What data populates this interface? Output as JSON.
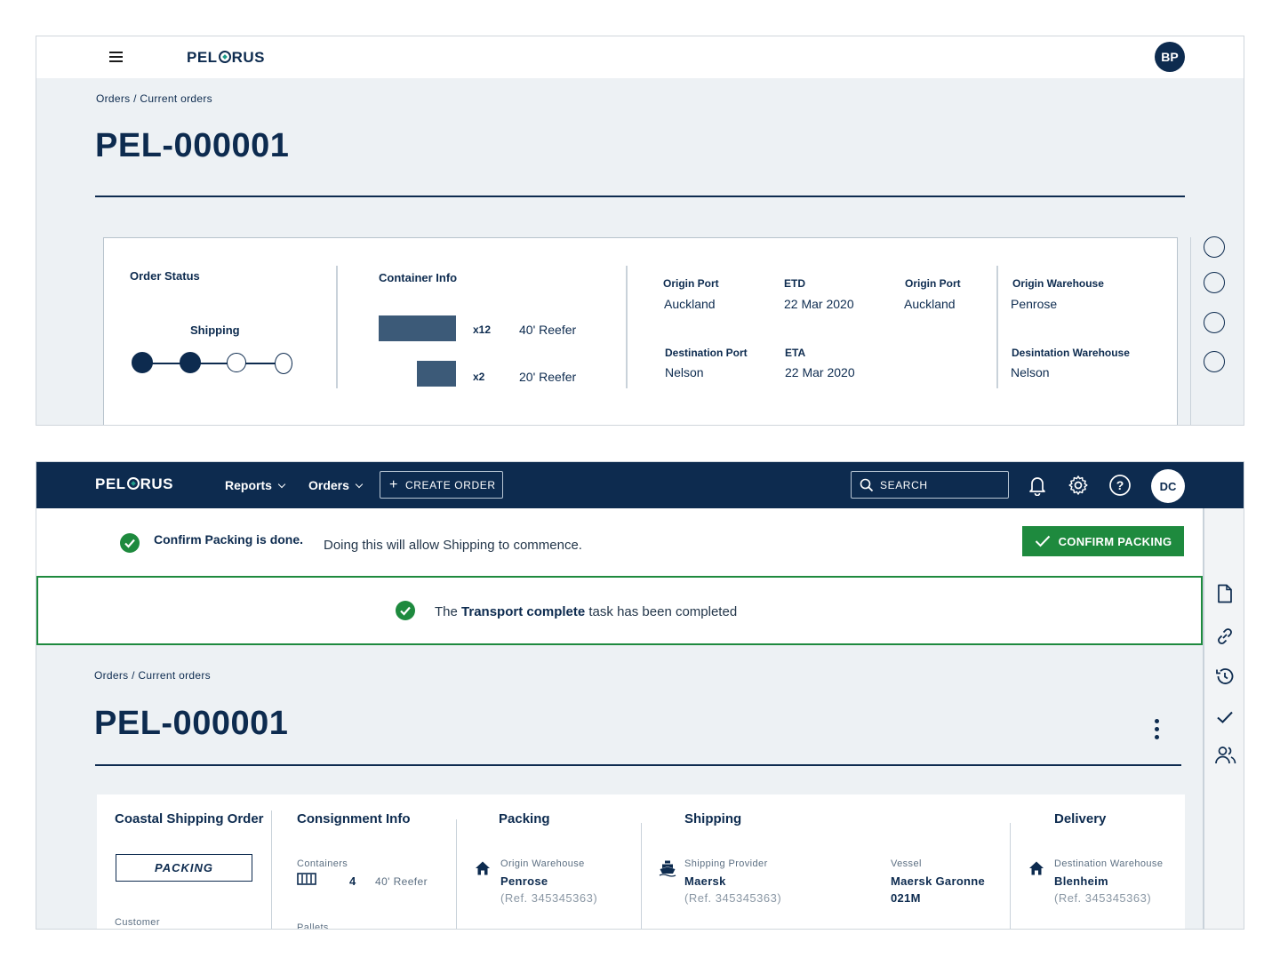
{
  "top": {
    "logo": {
      "left": "PEL",
      "right": "RUS"
    },
    "avatar": "BP",
    "breadcrumb": "Orders / Current orders",
    "title": "PEL-000001",
    "order_status": {
      "heading": "Order Status",
      "current": "Shipping",
      "steps_complete": 2,
      "steps_total": 4
    },
    "container_info": {
      "heading": "Container Info",
      "items": [
        {
          "qty": "x12",
          "type": "40' Reefer"
        },
        {
          "qty": "x2",
          "type": "20' Reefer"
        }
      ]
    },
    "route": {
      "origin_port_label": "Origin Port",
      "origin_port": "Auckland",
      "etd_label": "ETD",
      "etd": "22 Mar 2020",
      "origin_port2_label": "Origin Port",
      "origin_port2": "Auckland",
      "dest_port_label": "Destination Port",
      "dest_port": "Nelson",
      "eta_label": "ETA",
      "eta": "22 Mar 2020",
      "origin_wh_label": "Origin Warehouse",
      "origin_wh": "Penrose",
      "dest_wh_label": "Desintation Warehouse",
      "dest_wh": "Nelson"
    }
  },
  "bottom": {
    "logo": {
      "left": "PEL",
      "right": "RUS"
    },
    "nav": {
      "reports": "Reports",
      "orders": "Orders",
      "create": "CREATE ORDER",
      "search_placeholder": "SEARCH"
    },
    "avatar": "DC",
    "confirm": {
      "bold": "Confirm Packing is done.",
      "text": "Doing this will allow Shipping to commence.",
      "button": "CONFIRM PACKING"
    },
    "banner": {
      "pre": "The ",
      "bold": "Transport complete",
      "post": " task has been completed"
    },
    "breadcrumb": "Orders / Current orders",
    "title": "PEL-000001",
    "card": {
      "order_type": "Coastal Shipping Order",
      "status_pill": "PACKING",
      "customer_label": "Customer",
      "consignment": {
        "heading": "Consignment Info",
        "containers_label": "Containers",
        "containers_qty": "4",
        "containers_type": "40' Reefer",
        "pallets_label": "Pallets"
      },
      "packing": {
        "heading": "Packing",
        "label": "Origin Warehouse",
        "value": "Penrose",
        "ref": "(Ref. 345345363)"
      },
      "shipping": {
        "heading": "Shipping",
        "label": "Shipping Provider",
        "value": "Maersk",
        "ref": "(Ref. 345345363)",
        "vessel_label": "Vessel",
        "vessel_line1": "Maersk Garonne",
        "vessel_line2": "021M"
      },
      "delivery": {
        "heading": "Delivery",
        "label": "Destination Warehouse",
        "value": "Blenheim",
        "ref": "(Ref. 345345363)"
      }
    }
  },
  "colors": {
    "navy": "#0d2b4f",
    "green": "#1e8a3e",
    "bg": "#edf1f4",
    "bar": "#3c5a78"
  }
}
